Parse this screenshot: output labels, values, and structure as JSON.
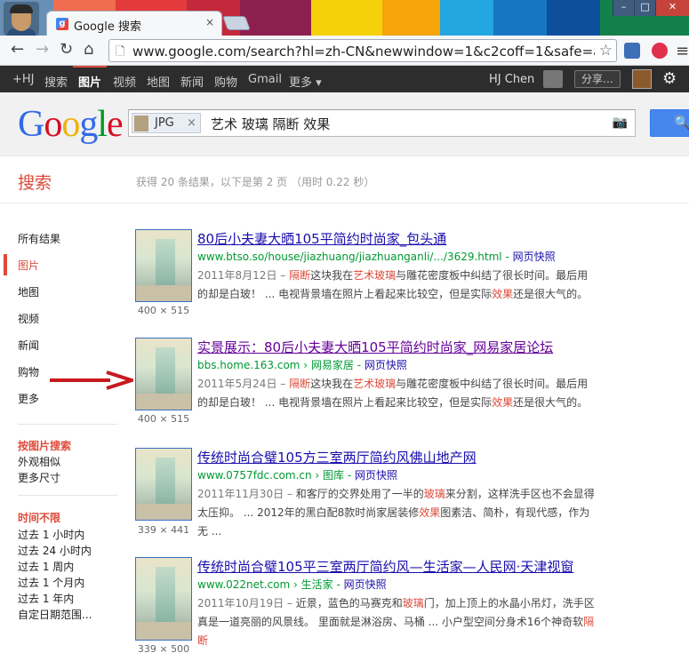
{
  "browser": {
    "tab_title": "Google 搜索",
    "tab_close": "×",
    "url": "www.google.com/search?hl=zh-CN&newwindow=1&c2coff=1&safe=ac",
    "win_min": "–",
    "win_max": "□",
    "win_close": "✕"
  },
  "gbar": {
    "items": [
      "+HJ",
      "搜索",
      "图片",
      "视频",
      "地图",
      "新闻",
      "购物",
      "Gmail",
      "更多 ▾"
    ],
    "active_index": 2,
    "user_name": "HJ Chen",
    "share_label": "分享…"
  },
  "search": {
    "logo_letters": [
      "G",
      "o",
      "o",
      "g",
      "l",
      "e"
    ],
    "logo_colors": [
      "#3369e8",
      "#d50f25",
      "#eeb211",
      "#3369e8",
      "#009925",
      "#d50f25"
    ],
    "chip_label": "JPG",
    "chip_close": "×",
    "query": "艺术 玻璃 隔断 效果",
    "button_icon": "🔍"
  },
  "subheader": {
    "title": "搜索",
    "stats": "获得 20 条结果，以下是第 2 页 （用时 0.22 秒）"
  },
  "leftnav": {
    "items": [
      "所有结果",
      "图片",
      "地图",
      "视频",
      "新闻",
      "购物",
      "更多"
    ],
    "active_index": 1,
    "image_search_heading": "按图片搜索",
    "image_search_options": [
      "外观相似",
      "更多尺寸"
    ],
    "time_heading": "时间不限",
    "time_options": [
      "过去 1 小时内",
      "过去 24 小时内",
      "过去 1 周内",
      "过去 1 个月内",
      "过去 1 年内",
      "自定日期范围..."
    ]
  },
  "results": [
    {
      "title": "80后小夫妻大晒105平简约时尚家_包头通",
      "url": "www.btso.so/house/jiazhuang/jiazhuanganli/.../3629.html",
      "url_sep": " - ",
      "cache": "网页快照",
      "dims": "400 × 515",
      "date": "2011年8月12日 –",
      "snippet": [
        {
          "t": " ",
          "h": false
        },
        {
          "t": "隔断",
          "h": true
        },
        {
          "t": "这块我在",
          "h": false
        },
        {
          "t": "艺术玻璃",
          "h": true
        },
        {
          "t": "与雕花密度板中纠结了很长时间。最后用的却是白玻！ ... 电视背景墙在照片上看起来比较空，但是实际",
          "h": false
        },
        {
          "t": "效果",
          "h": true
        },
        {
          "t": "还是很大气的。",
          "h": false
        }
      ]
    },
    {
      "title": "实景展示：80后小夫妻大晒105平简约时尚家_网易家居论坛",
      "url": "bbs.home.163.com › 网易家居",
      "url_sep": " - ",
      "cache": "网页快照",
      "dims": "400 × 515",
      "date": "2011年5月24日 –",
      "snippet": [
        {
          "t": " ",
          "h": false
        },
        {
          "t": "隔断",
          "h": true
        },
        {
          "t": "这块我在",
          "h": false
        },
        {
          "t": "艺术玻璃",
          "h": true
        },
        {
          "t": "与雕花密度板中纠结了很长时间。最后用的却是白玻！ ... 电视背景墙在照片上看起来比较空，但是实际",
          "h": false
        },
        {
          "t": "效果",
          "h": true
        },
        {
          "t": "还是很大气的。",
          "h": false
        }
      ]
    },
    {
      "title": "传统时尚合璧105方三室两厅简约风佛山地产网",
      "url": "www.0757fdc.com.cn › 图库",
      "url_sep": " - ",
      "cache": "网页快照",
      "dims": "339 × 441",
      "date": "2011年11月30日 –",
      "snippet": [
        {
          "t": " 和客厅的交界处用了一半的",
          "h": false
        },
        {
          "t": "玻璃",
          "h": true
        },
        {
          "t": "来分割，这样洗手区也不会显得太压抑。 ... 2012年的黑白配8款时尚家居装修",
          "h": false
        },
        {
          "t": "效果",
          "h": true
        },
        {
          "t": "图素洁、简朴，有现代感，作为无 ...",
          "h": false
        }
      ]
    },
    {
      "title": "传统时尚合璧105平三室两厅简约风—生活家—人民网·天津视窗",
      "url": "www.022net.com › 生活家",
      "url_sep": " - ",
      "cache": "网页快照",
      "dims": "339 × 500",
      "date": "2011年10月19日 –",
      "snippet": [
        {
          "t": " 近景，蓝色的马赛克和",
          "h": false
        },
        {
          "t": "玻璃",
          "h": true
        },
        {
          "t": "门，加上顶上的水晶小吊灯，洗手区真是一道亮丽的风景线。 里面就是淋浴房、马桶 ... 小户型空间分身术16个神奇软",
          "h": false
        },
        {
          "t": "隔断",
          "h": true
        }
      ]
    }
  ]
}
